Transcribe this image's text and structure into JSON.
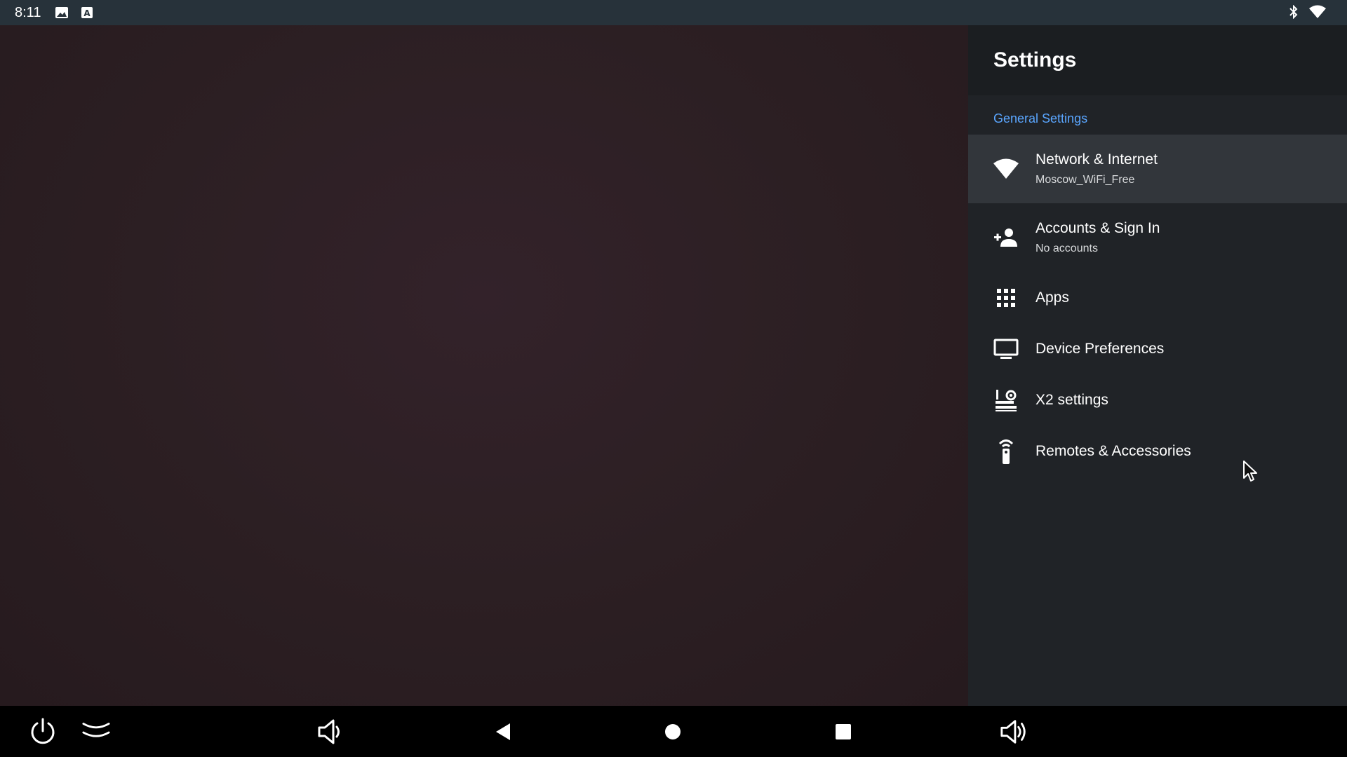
{
  "status_bar": {
    "time": "8:11",
    "left_icons": [
      "image-icon",
      "text-a-icon"
    ],
    "right_icons": [
      "bluetooth-icon",
      "wifi-icon"
    ]
  },
  "panel": {
    "title": "Settings",
    "section": "General Settings",
    "items": [
      {
        "label": "Network & Internet",
        "sublabel": "Moscow_WiFi_Free",
        "icon": "wifi-icon",
        "selected": true
      },
      {
        "label": "Accounts & Sign In",
        "sublabel": "No accounts",
        "icon": "add-person-icon"
      },
      {
        "label": "Apps",
        "icon": "apps-grid-icon"
      },
      {
        "label": "Device Preferences",
        "icon": "tv-icon"
      },
      {
        "label": "X2 settings",
        "icon": "x2-settings-icon"
      },
      {
        "label": "Remotes & Accessories",
        "icon": "remote-icon"
      }
    ]
  },
  "nav_bar": {
    "buttons": [
      "power-icon",
      "collapse-icon",
      "volume-down-icon",
      "back-icon",
      "home-icon",
      "recents-icon",
      "volume-up-icon"
    ]
  },
  "colors": {
    "accent": "#5aa6ff",
    "panel_bg": "#202327",
    "panel_header_bg": "#1b1e21",
    "selected_bg": "#32363b",
    "status_bar_bg": "#27323a"
  }
}
